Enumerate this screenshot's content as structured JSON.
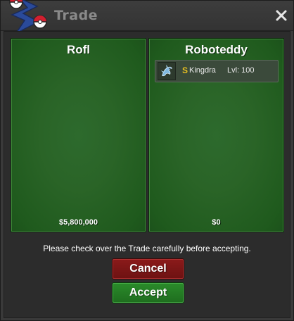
{
  "window": {
    "title": "Trade",
    "icons": {
      "logo": "pokeball-logo-icon",
      "close": "close-icon"
    }
  },
  "trade": {
    "left": {
      "player": "Rofl",
      "money": "$5,800,000",
      "items": []
    },
    "right": {
      "player": "Roboteddy",
      "money": "$0",
      "items": [
        {
          "icon": "kingdra-sprite-icon",
          "shiny_marker": "S",
          "name": "Kingdra",
          "level": "Lvl: 100"
        }
      ]
    }
  },
  "notice": "Please check over the Trade carefully before accepting.",
  "buttons": {
    "cancel": "Cancel",
    "accept": "Accept"
  },
  "colors": {
    "panel_green": "#2a6427",
    "cancel_red": "#7a1616",
    "accept_green": "#267a26",
    "shiny_gold": "#e8c020"
  }
}
